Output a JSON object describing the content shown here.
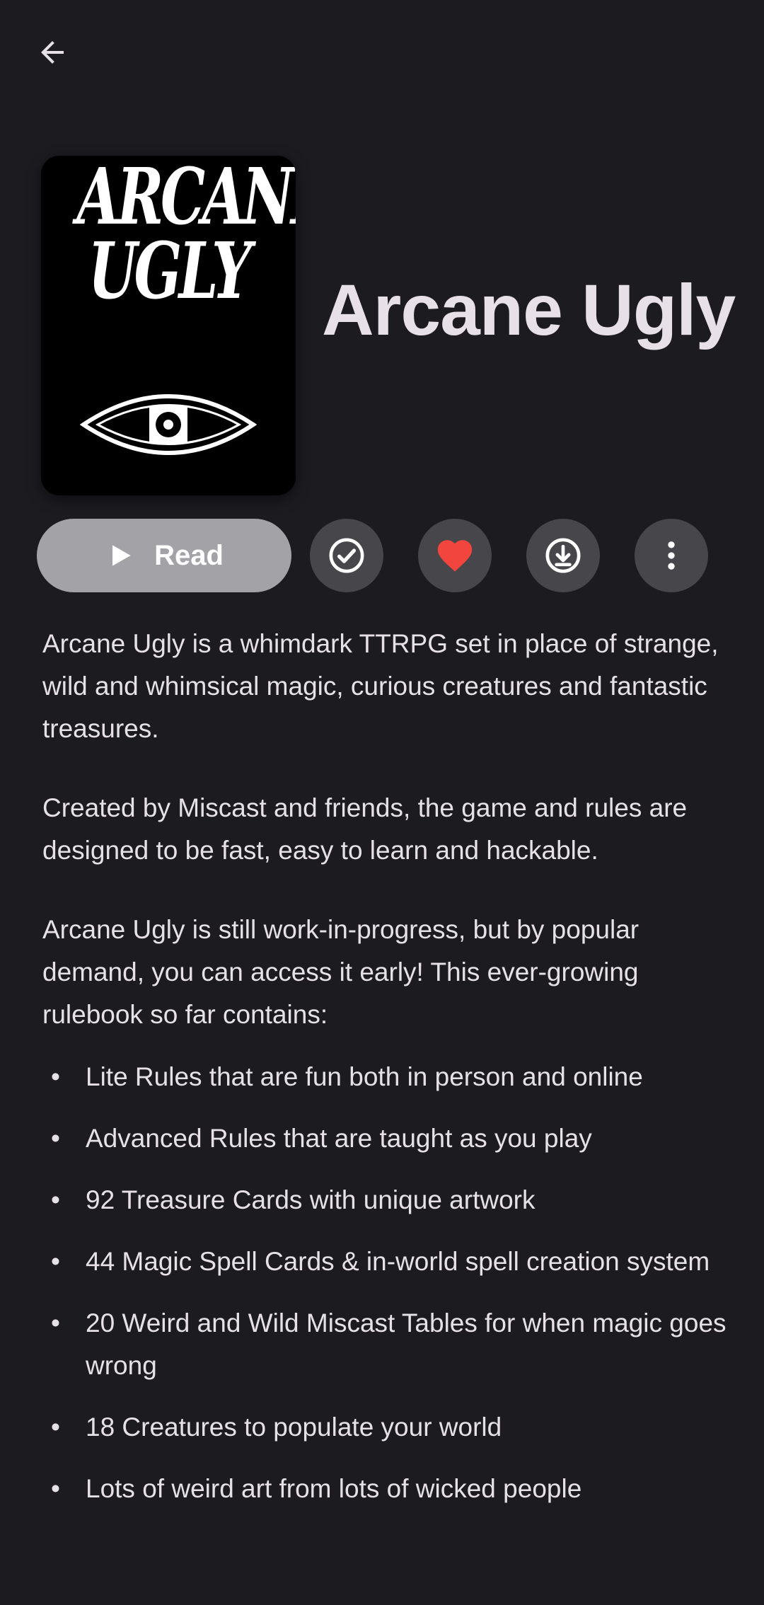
{
  "header": {
    "back_icon": "arrow-back-icon"
  },
  "book": {
    "title": "Arcane Ugly",
    "cover_title_line1": "ARCANE",
    "cover_title_line2": "UGLY"
  },
  "actions": {
    "read_label": "Read",
    "read_icon": "play-icon",
    "mark_read_icon": "check-circle-icon",
    "favorite_icon": "heart-icon",
    "download_icon": "download-icon",
    "more_icon": "more-vert-icon",
    "colors": {
      "read_bg": "#a3a2a6",
      "round_bg": "#47464b",
      "favorite": "#f2453d"
    }
  },
  "description": {
    "paragraphs": [
      "Arcane Ugly is a whimdark TTRPG set in place of strange, wild and whimsical magic, curious creatures and fantastic treasures.",
      "Created by Miscast and friends, the game and rules are designed to be fast, easy to learn and hackable.",
      "Arcane Ugly is still work-in-progress, but by popular demand, you can access it early! This ever-growing rulebook so far contains:"
    ],
    "bullet_char": "•",
    "bullets": [
      "Lite Rules that are fun both in person and online",
      "Advanced Rules that are taught as you play",
      "92 Treasure Cards with unique artwork",
      "44 Magic Spell Cards & in-world spell creation system",
      "20 Weird and Wild Miscast Tables for when magic goes wrong",
      "18 Creatures to populate your world",
      "Lots of weird art from lots of wicked people"
    ]
  }
}
